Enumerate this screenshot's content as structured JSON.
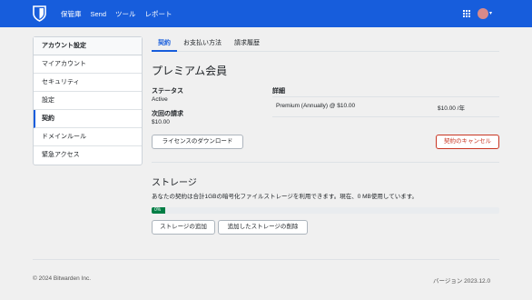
{
  "nav": {
    "links": [
      "保管庫",
      "Send",
      "ツール",
      "レポート"
    ]
  },
  "sidebar": {
    "title": "アカウント設定",
    "items": [
      {
        "label": "マイアカウント"
      },
      {
        "label": "セキュリティ"
      },
      {
        "label": "設定"
      },
      {
        "label": "契約"
      },
      {
        "label": "ドメインルール"
      },
      {
        "label": "緊急アクセス"
      }
    ]
  },
  "tabs": [
    "契約",
    "お支払い方法",
    "請求履歴"
  ],
  "subscription": {
    "title": "プレミアム会員",
    "status_label": "ステータス",
    "status_value": "Active",
    "next_charge_label": "次回の請求",
    "next_charge_value": "$10.00",
    "details_label": "詳細",
    "line_item": "Premium (Annually) @ $10.00",
    "line_price": "$10.00 /年",
    "download_license": "ライセンスのダウンロード",
    "cancel_button": "契約のキャンセル"
  },
  "storage": {
    "title": "ストレージ",
    "description": "あなたの契約は合計1GBの暗号化ファイルストレージを利用できます。現在、0 MB使用しています。",
    "percent_label": "0%",
    "percent_value": 0,
    "add_button": "ストレージの追加",
    "remove_button": "追加したストレージの削除"
  },
  "footer": {
    "copyright": "© 2024 Bitwarden Inc.",
    "version": "バージョン 2023.12.0"
  },
  "colors": {
    "brand": "#175ddc",
    "danger": "#c83522",
    "progress": "#017e45"
  }
}
